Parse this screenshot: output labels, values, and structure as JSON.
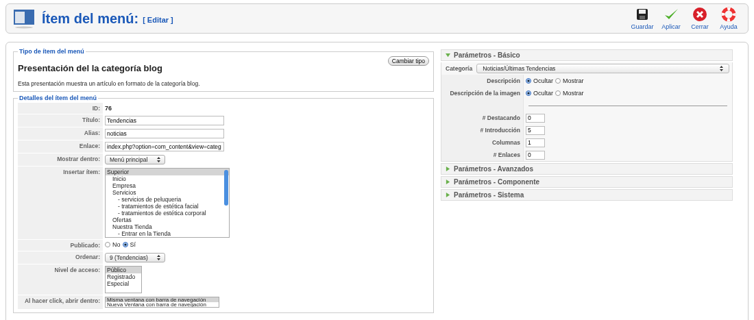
{
  "header": {
    "title": "Ítem del menú:",
    "subtitle": "[ Editar ]"
  },
  "toolbar": [
    {
      "kind": "save",
      "label": "Guardar"
    },
    {
      "kind": "apply",
      "label": "Aplicar"
    },
    {
      "kind": "close",
      "label": "Cerrar"
    },
    {
      "kind": "help",
      "label": "Ayuda"
    }
  ],
  "menu_type": {
    "legend": "Tipo de ítem del menú",
    "name": "Presentación del la categoría blog",
    "description": "Esta presentación muestra un artículo en formato de la categoría blog.",
    "change_button": "Cambiar tipo"
  },
  "details": {
    "legend": "Detalles del ítem del menú",
    "rows": [
      {
        "kind": "static",
        "label": "ID:",
        "value": "76"
      },
      {
        "kind": "text",
        "label": "Título:",
        "value": "Tendencias"
      },
      {
        "kind": "text",
        "label": "Alias:",
        "value": "noticias"
      },
      {
        "kind": "text",
        "label": "Enlace:",
        "value": "index.php?option=com_content&view=categ"
      },
      {
        "kind": "select",
        "label": "Mostrar dentro:",
        "value": "Menú principal"
      },
      {
        "kind": "tree",
        "label": "Insertar ítem:",
        "options": [
          {
            "label": "Superior",
            "selected": true,
            "children": [
              {
                "label": "Inicio",
                "selected": false
              },
              {
                "label": "Empresa",
                "selected": false
              },
              {
                "label": "Servicios",
                "selected": false,
                "children": [
                  {
                    "label": "- servicios de peluqueria",
                    "selected": false
                  },
                  {
                    "label": "- tratamientos de estética facial",
                    "selected": false
                  },
                  {
                    "label": "- tratamientos de estética corporal",
                    "selected": false
                  }
                ]
              },
              {
                "label": "Ofertas",
                "selected": false
              },
              {
                "label": "Nuestra Tienda",
                "selected": false,
                "children": [
                  {
                    "label": "- Entrar en la Tienda",
                    "selected": false
                  }
                ]
              }
            ]
          }
        ]
      },
      {
        "kind": "radio",
        "label": "Publicado:",
        "options": [
          {
            "label": "No",
            "selected": false
          },
          {
            "label": "Sí",
            "selected": true
          }
        ]
      },
      {
        "kind": "select",
        "label": "Ordenar:",
        "value": "9 (Tendencias)"
      },
      {
        "kind": "list",
        "label": "Nivel de acceso:",
        "options": [
          {
            "label": "Público",
            "selected": true
          },
          {
            "label": "Registrado",
            "selected": false
          },
          {
            "label": "Especial",
            "selected": false
          }
        ]
      },
      {
        "kind": "list",
        "label": "Al hacer click, abrir dentro:",
        "options": [
          {
            "label": "Misma ventana con barra de navegación",
            "selected": true
          },
          {
            "label": "Nueva Ventana con barra de navegación",
            "selected": false
          }
        ]
      }
    ]
  },
  "panels": [
    {
      "title": "Parámetros - Básico",
      "expanded": true,
      "rows": [
        {
          "kind": "wideselect",
          "label": "Categoría",
          "value": "Noticias/Últimas Tendencias"
        },
        {
          "kind": "radio",
          "label": "Descripción",
          "options": [
            {
              "label": "Ocultar",
              "selected": true
            },
            {
              "label": "Mostrar",
              "selected": false
            }
          ]
        },
        {
          "kind": "radio",
          "label": "Descripción de la imagen",
          "options": [
            {
              "label": "Ocultar",
              "selected": true
            },
            {
              "label": "Mostrar",
              "selected": false
            }
          ]
        },
        {
          "kind": "separator"
        },
        {
          "kind": "text",
          "label": "# Destacando",
          "value": "0"
        },
        {
          "kind": "text",
          "label": "# Introducción",
          "value": "5"
        },
        {
          "kind": "text",
          "label": "Columnas",
          "value": "1"
        },
        {
          "kind": "text",
          "label": "# Enlaces",
          "value": "0"
        }
      ]
    },
    {
      "title": "Parámetros - Avanzados",
      "expanded": false
    },
    {
      "title": "Parámetros - Componente",
      "expanded": false
    },
    {
      "title": "Parámetros - Sistema",
      "expanded": false
    }
  ]
}
